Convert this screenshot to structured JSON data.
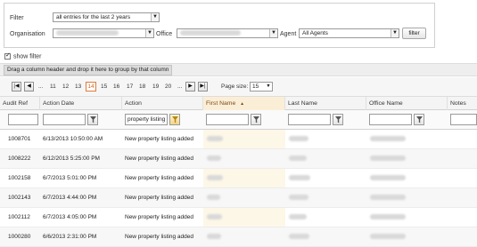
{
  "filter": {
    "filter_label": "Filter",
    "filter_value": "all entries for the last 2 years",
    "org_label": "Organisation",
    "office_label": "Office",
    "agent_label": "Agent",
    "agent_value": "All Agents",
    "filter_button": "filter"
  },
  "show_filter_label": "show filter",
  "group_hint": "Drag a column header and drop it here to group by that column",
  "pager": {
    "ellipsis": "...",
    "pages": [
      "11",
      "12",
      "13",
      "14",
      "15",
      "16",
      "17",
      "18",
      "19",
      "20"
    ],
    "current_page": "14",
    "page_size_label": "Page size:",
    "page_size": "15"
  },
  "columns": [
    "Audit Ref",
    "Action Date",
    "Action",
    "First Name",
    "Last Name",
    "Office Name",
    "Notes"
  ],
  "sorted_column": "First Name",
  "action_filter_value": "property listing",
  "rows": [
    {
      "ref": "1008701",
      "date": "6/13/2013 10:50:00 AM",
      "action": "New property listing added"
    },
    {
      "ref": "1008222",
      "date": "6/12/2013 5:25:00 PM",
      "action": "New property listing added"
    },
    {
      "ref": "1002158",
      "date": "6/7/2013 5:01:00 PM",
      "action": "New property listing added"
    },
    {
      "ref": "1002143",
      "date": "6/7/2013 4:44:00 PM",
      "action": "New property listing added"
    },
    {
      "ref": "1002112",
      "date": "6/7/2013 4:05:00 PM",
      "action": "New property listing added"
    },
    {
      "ref": "1000280",
      "date": "6/6/2013 2:31:00 PM",
      "action": "New property listing added"
    }
  ]
}
